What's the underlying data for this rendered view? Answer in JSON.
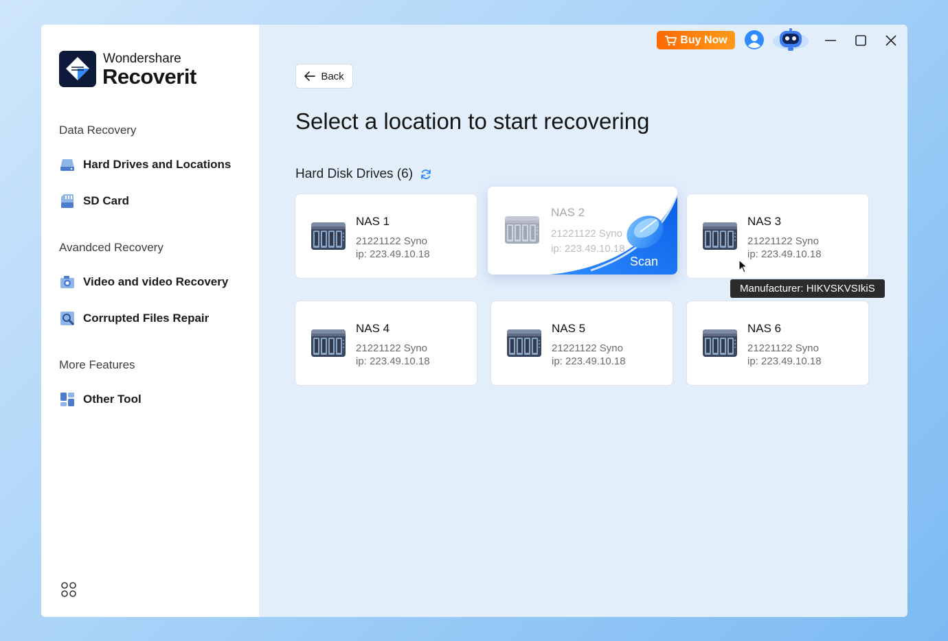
{
  "app": {
    "brand_top": "Wondershare",
    "brand_main": "Recoverit"
  },
  "sidebar": {
    "sections": [
      {
        "title": "Data Recovery"
      },
      {
        "title": "Avandced Recovery"
      },
      {
        "title": "More Features"
      }
    ],
    "items": [
      {
        "label": "Hard Drives and Locations",
        "icon": "hard-drive-icon"
      },
      {
        "label": "SD Card",
        "icon": "sd-card-icon"
      },
      {
        "label": "Video and video Recovery",
        "icon": "camera-icon"
      },
      {
        "label": "Corrupted Files Repair",
        "icon": "repair-icon"
      },
      {
        "label": "Other Tool",
        "icon": "tools-icon"
      }
    ]
  },
  "topbar": {
    "buy_label": "Buy Now"
  },
  "main": {
    "back_label": "Back",
    "title": "Select a location to start recovering",
    "group_title": "Hard Disk Drives (6)",
    "scan_label": "Scan",
    "tooltip": "Manufacturer: HIKVSKVSIkiS",
    "devices": [
      {
        "name": "NAS 1",
        "model": "21221122 Syno",
        "ip": "ip: 223.49.10.18"
      },
      {
        "name": "NAS 2",
        "model": "21221122 Syno",
        "ip": "ip: 223.49.10.18"
      },
      {
        "name": "NAS 3",
        "model": "21221122 Syno",
        "ip": "ip: 223.49.10.18"
      },
      {
        "name": "NAS 4",
        "model": "21221122 Syno",
        "ip": "ip: 223.49.10.18"
      },
      {
        "name": "NAS 5",
        "model": "21221122 Syno",
        "ip": "ip: 223.49.10.18"
      },
      {
        "name": "NAS 6",
        "model": "21221122 Syno",
        "ip": "ip: 223.49.10.18"
      }
    ]
  },
  "colors": {
    "accent": "#0a6cf5",
    "buy_button": "#ff7a00",
    "brand_dark": "#0e1a3a"
  }
}
